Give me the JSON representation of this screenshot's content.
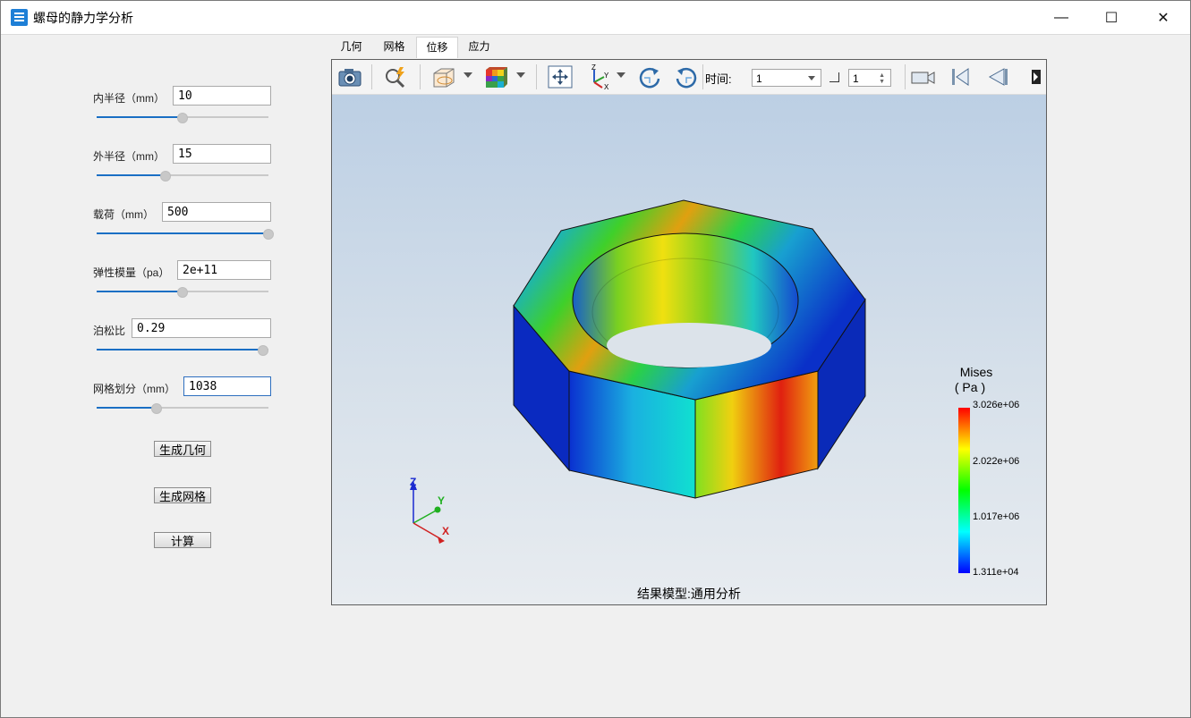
{
  "window": {
    "title": "螺母的静力学分析",
    "minimize_symbol": "—",
    "maximize_symbol": "☐",
    "close_symbol": "✕"
  },
  "params": [
    {
      "label": "内半径（mm）",
      "value": "10",
      "slider": 0.5
    },
    {
      "label": "外半径（mm）",
      "value": "15",
      "slider": 0.4
    },
    {
      "label": "载荷（mm）",
      "value": "500",
      "slider": 1.0
    },
    {
      "label": "弹性模量（pa）",
      "value": "2e+11",
      "slider": 0.5
    },
    {
      "label": "泊松比",
      "value": "0.29",
      "slider": 0.97
    },
    {
      "label": "网格划分（mm）",
      "value": "1038",
      "slider": 0.35
    }
  ],
  "buttons": {
    "gen_geom": "生成几何",
    "gen_mesh": "生成网格",
    "compute": "计算"
  },
  "tabs": [
    "几何",
    "网格",
    "位移",
    "应力"
  ],
  "active_tab": "位移",
  "toolbar": {
    "time_label": "时间:",
    "time_value": "1",
    "step_value": "1",
    "icons": [
      "camera-icon",
      "zoom-fit-icon",
      "view-cube-icon",
      "color-display-icon",
      "pan-icon",
      "axes-icon",
      "rotate-cw-icon",
      "rotate-ccw-icon",
      "record-icon",
      "first-frame-icon",
      "prev-frame-icon",
      "more-icon"
    ]
  },
  "legend": {
    "title_line1": "Mises",
    "title_line2": "( Pa )",
    "labels": [
      "3.026e+06",
      "2.022e+06",
      "1.017e+06",
      "1.311e+04"
    ],
    "colors": [
      "#ff0000",
      "#ffff00",
      "#00ff00",
      "#00ffff",
      "#0000ff"
    ]
  },
  "axes": {
    "z": "Z",
    "y": "Y",
    "x": "X"
  },
  "caption": "结果模型:通用分析"
}
